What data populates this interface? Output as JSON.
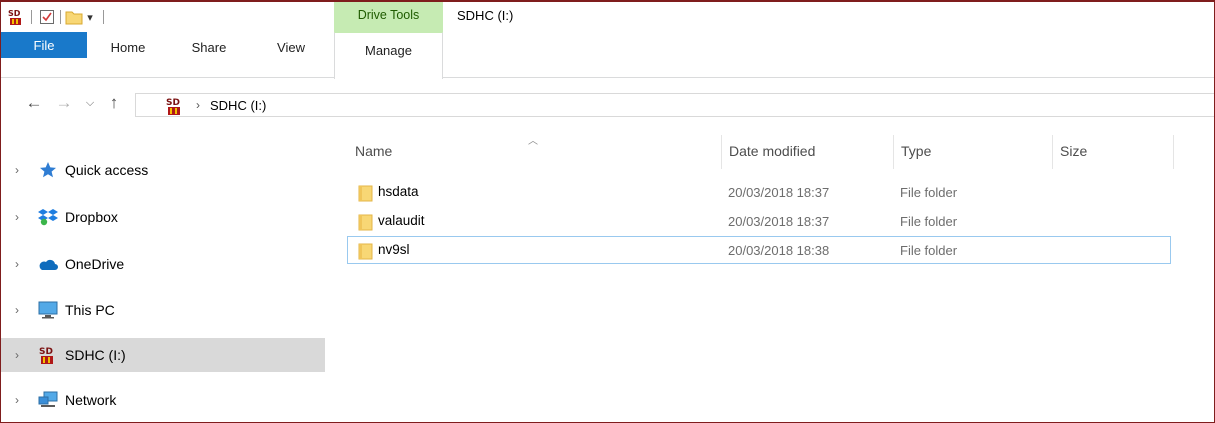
{
  "window": {
    "title": "SDHC (I:)",
    "context_group_label": "Drive Tools"
  },
  "quick_access_toolbar": {
    "icons": [
      "sd-card-icon",
      "properties-checkbox-icon",
      "new-folder-icon",
      "customize-dropdown-icon"
    ]
  },
  "ribbon": {
    "tabs": [
      {
        "label": "File",
        "active": false
      },
      {
        "label": "Home",
        "active": false
      },
      {
        "label": "Share",
        "active": false
      },
      {
        "label": "View",
        "active": false
      },
      {
        "label": "Manage",
        "active": true
      }
    ]
  },
  "address_bar": {
    "crumbs": [
      "SDHC (I:)"
    ]
  },
  "nav_pane": {
    "items": [
      {
        "label": "Quick access",
        "icon": "star-icon"
      },
      {
        "label": "Dropbox",
        "icon": "dropbox-icon"
      },
      {
        "label": "OneDrive",
        "icon": "onedrive-cloud-icon"
      },
      {
        "label": "This PC",
        "icon": "monitor-icon"
      },
      {
        "label": "SDHC (I:)",
        "icon": "sd-card-icon",
        "selected": true
      },
      {
        "label": "Network",
        "icon": "network-icon"
      }
    ]
  },
  "file_list": {
    "columns": {
      "name": "Name",
      "date": "Date modified",
      "type": "Type",
      "size": "Size"
    },
    "rows": [
      {
        "name": "hsdata",
        "date": "20/03/2018 18:37",
        "type": "File folder"
      },
      {
        "name": "valaudit",
        "date": "20/03/2018 18:37",
        "type": "File folder"
      },
      {
        "name": "nv9sl",
        "date": "20/03/2018 18:38",
        "type": "File folder",
        "focused": true
      }
    ]
  },
  "colors": {
    "file_tab": "#1979ca",
    "context_group": "#c6ebb3",
    "selected_nav": "#d9d9d9",
    "focus_border": "#99c9ef",
    "window_border": "#7f1d1d",
    "folder_yellow": "#f8d775"
  }
}
